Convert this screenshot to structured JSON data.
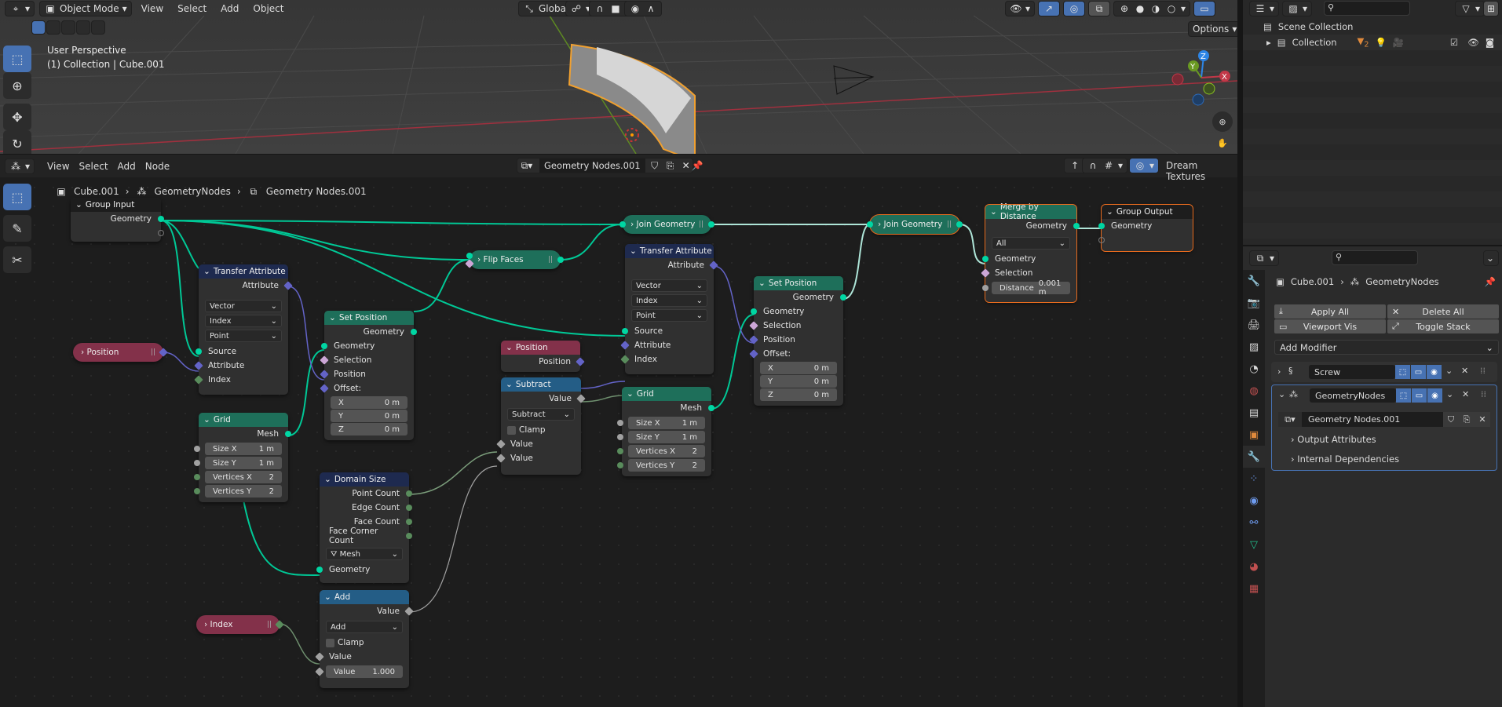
{
  "viewport": {
    "header": {
      "editor_icon": "view3d-icon",
      "mode": "Object Mode",
      "menus": [
        "View",
        "Select",
        "Add",
        "Object"
      ],
      "orientation": "Global",
      "options_label": "Options"
    },
    "overlay_title": "User Perspective",
    "overlay_subtitle": "(1) Collection | Cube.001",
    "gizmo_axes": {
      "x": "X",
      "y": "Y",
      "z": "Z"
    },
    "colors": {
      "selection_outline": "#f0a030",
      "x_axis": "#c23848",
      "y_axis": "#6a9a22",
      "z_axis": "#2d85e6"
    }
  },
  "node_editor": {
    "menus": [
      "View",
      "Select",
      "Add",
      "Node"
    ],
    "node_group": "Geometry Nodes.001",
    "addon_label": "Dream Textures",
    "breadcrumb": [
      "Cube.001",
      "GeometryNodes",
      "Geometry Nodes.001"
    ],
    "nodes": {
      "group_input": {
        "title": "Group Input",
        "outputs": [
          "Geometry"
        ]
      },
      "transfer_attr_1": {
        "title": "Transfer Attribute",
        "output": "Attribute",
        "data_type": "Vector",
        "mapping": "Index",
        "domain": "Point",
        "inputs": [
          "Source",
          "Attribute",
          "Index"
        ]
      },
      "position_1": {
        "title": "Position"
      },
      "grid_1": {
        "title": "Grid",
        "output": "Mesh",
        "fields": [
          {
            "label": "Size X",
            "value": "1 m"
          },
          {
            "label": "Size Y",
            "value": "1 m"
          },
          {
            "label": "Vertices X",
            "value": "2"
          },
          {
            "label": "Vertices Y",
            "value": "2"
          }
        ]
      },
      "set_position_1": {
        "title": "Set Position",
        "output": "Geometry",
        "inputs": [
          "Geometry",
          "Selection",
          "Position",
          "Offset:"
        ],
        "offset": [
          {
            "label": "X",
            "value": "0 m"
          },
          {
            "label": "Y",
            "value": "0 m"
          },
          {
            "label": "Z",
            "value": "0 m"
          }
        ]
      },
      "domain_size": {
        "title": "Domain Size",
        "outputs": [
          "Point Count",
          "Edge Count",
          "Face Count",
          "Face Corner Count"
        ],
        "component": "Mesh",
        "input": "Geometry"
      },
      "add": {
        "title": "Add",
        "output": "Value",
        "operation": "Add",
        "clamp_label": "Clamp",
        "input": "Value",
        "value_label": "Value",
        "value": "1.000"
      },
      "index": {
        "title": "Index"
      },
      "flip_faces": {
        "title": "Flip Faces"
      },
      "join_1": {
        "title": "Join Geometry"
      },
      "transfer_attr_2": {
        "title": "Transfer Attribute",
        "output": "Attribute",
        "data_type": "Vector",
        "mapping": "Index",
        "domain": "Point",
        "inputs": [
          "Source",
          "Attribute",
          "Index"
        ]
      },
      "position_2": {
        "title": "Position",
        "output": "Position"
      },
      "subtract": {
        "title": "Subtract",
        "output": "Value",
        "operation": "Subtract",
        "clamp_label": "Clamp",
        "inputs": [
          "Value",
          "Value"
        ]
      },
      "grid_2": {
        "title": "Grid",
        "output": "Mesh",
        "fields": [
          {
            "label": "Size X",
            "value": "1 m"
          },
          {
            "label": "Size Y",
            "value": "1 m"
          },
          {
            "label": "Vertices X",
            "value": "2"
          },
          {
            "label": "Vertices Y",
            "value": "2"
          }
        ]
      },
      "set_position_2": {
        "title": "Set Position",
        "output": "Geometry",
        "inputs": [
          "Geometry",
          "Selection",
          "Position",
          "Offset:"
        ],
        "offset": [
          {
            "label": "X",
            "value": "0 m"
          },
          {
            "label": "Y",
            "value": "0 m"
          },
          {
            "label": "Z",
            "value": "0 m"
          }
        ]
      },
      "join_2": {
        "title": "Join Geometry"
      },
      "merge": {
        "title": "Merge by Distance",
        "output": "Geometry",
        "mode": "All",
        "inputs": [
          "Geometry",
          "Selection"
        ],
        "distance_label": "Distance",
        "distance": "0.001 m"
      },
      "group_output": {
        "title": "Group Output",
        "inputs": [
          "Geometry"
        ]
      }
    },
    "colors": {
      "geometry_socket": "#00d6a3",
      "vector_socket": "#6363c7",
      "float_socket": "#a1a1a1",
      "int_socket": "#598c5c",
      "selected_outline": "#e86b1e"
    }
  },
  "outliner": {
    "search_placeholder": "",
    "items": [
      {
        "label": "Scene Collection",
        "icon": "collection-icon"
      },
      {
        "label": "Collection",
        "icon": "collection-icon",
        "badge_count": "2",
        "visible": true
      }
    ]
  },
  "properties": {
    "search_placeholder": "",
    "breadcrumb": [
      "Cube.001",
      "GeometryNodes"
    ],
    "buttons": {
      "apply_all": "Apply All",
      "delete_all": "Delete All",
      "viewport_vis": "Viewport Vis",
      "toggle_stack": "Toggle Stack"
    },
    "add_modifier": "Add Modifier",
    "modifiers": [
      {
        "name": "Screw",
        "expanded": false
      },
      {
        "name": "GeometryNodes",
        "expanded": true,
        "node_group": "Geometry Nodes.001",
        "panels": [
          "Output Attributes",
          "Internal Dependencies"
        ]
      }
    ],
    "tabs": [
      "tool",
      "render",
      "output",
      "view-layer",
      "scene",
      "world",
      "collection",
      "object",
      "modifiers",
      "particles",
      "physics",
      "constraints",
      "data",
      "material",
      "texture"
    ],
    "active_tab": "modifiers"
  }
}
